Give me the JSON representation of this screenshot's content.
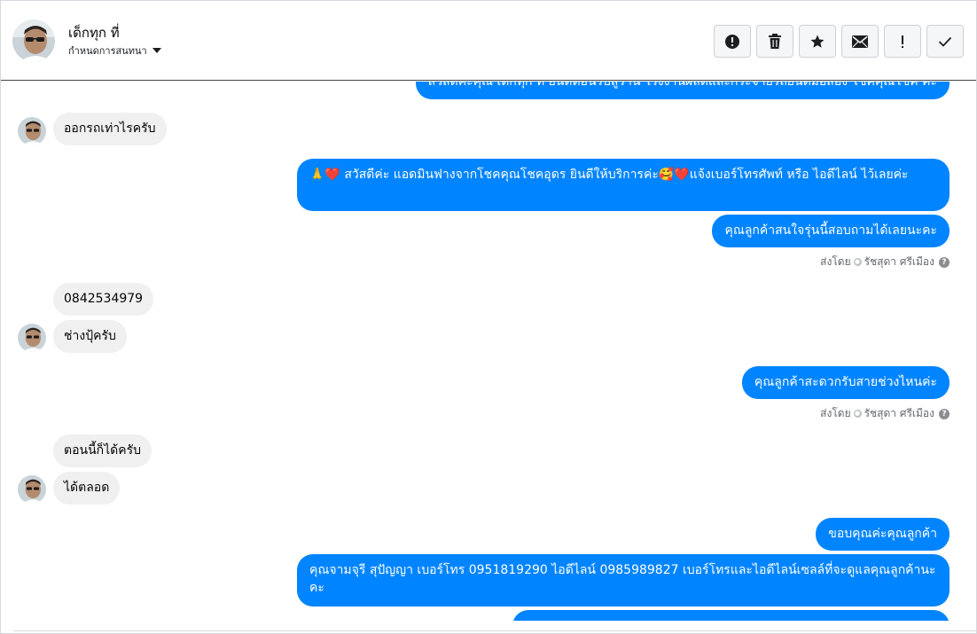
{
  "header": {
    "contact_name": "เด็กทุก ที่",
    "assign_label": "กำหนดการสนทนา",
    "actions": [
      {
        "name": "report",
        "icon": "alert-circle-icon"
      },
      {
        "name": "delete",
        "icon": "trash-icon"
      },
      {
        "name": "star",
        "icon": "star-icon"
      },
      {
        "name": "mark-unread",
        "icon": "envelope-icon"
      },
      {
        "name": "spam",
        "icon": "exclamation-icon"
      },
      {
        "name": "done",
        "icon": "checkmark-icon"
      }
    ]
  },
  "messages": {
    "m0": "สวัสดีค่ะคุณ เด็กทุก ที่ ยินดีต้อนรับสู่ร้าน โรงงานผลิตและกระจายรถยนต์มือสอง โชคคุณโชค ค่ะ",
    "m1": "ออกรถเท่าไรครับ",
    "m2": "🙏❤️ สวัสดีค่ะ แอดมินฟางจากโชคคุณโชคอุดร ยินดีให้บริการค่ะ🥰❤️แจ้งเบอร์โทรศัพท์ หรือ ไอดีไลน์  ไว้เลยค่ะ",
    "m3": "คุณลูกค้าสนใจรุ่นนี้สอบถามได้เลยนะคะ",
    "m4": "0842534979",
    "m5": "ช่างปุ้ครับ",
    "m6": "คุณลูกค้าสะดวกรับสายช่วงไหนค่ะ",
    "m7": "ตอนนี้ก็ได้ครับ",
    "m8": "ได้ตลอด",
    "m9": "ขอบคุณค่ะคุณลูกค้า",
    "m10": "คุณจามจุรี สุปัญญา เบอร์โทร 0951819290  ไอดีไลน์ 0985989827   เบอร์โทรและไอดีไลน์เซลล์ที่จะดูแลคุณลูกค้านะคะ",
    "m11": ""
  },
  "sent_by": {
    "label": "ส่งโดย",
    "agent": "รัชสุดา ศรีเมือง",
    "help": "?"
  },
  "colors": {
    "outgoing": "#0084ff",
    "incoming": "#f0f0f0"
  }
}
